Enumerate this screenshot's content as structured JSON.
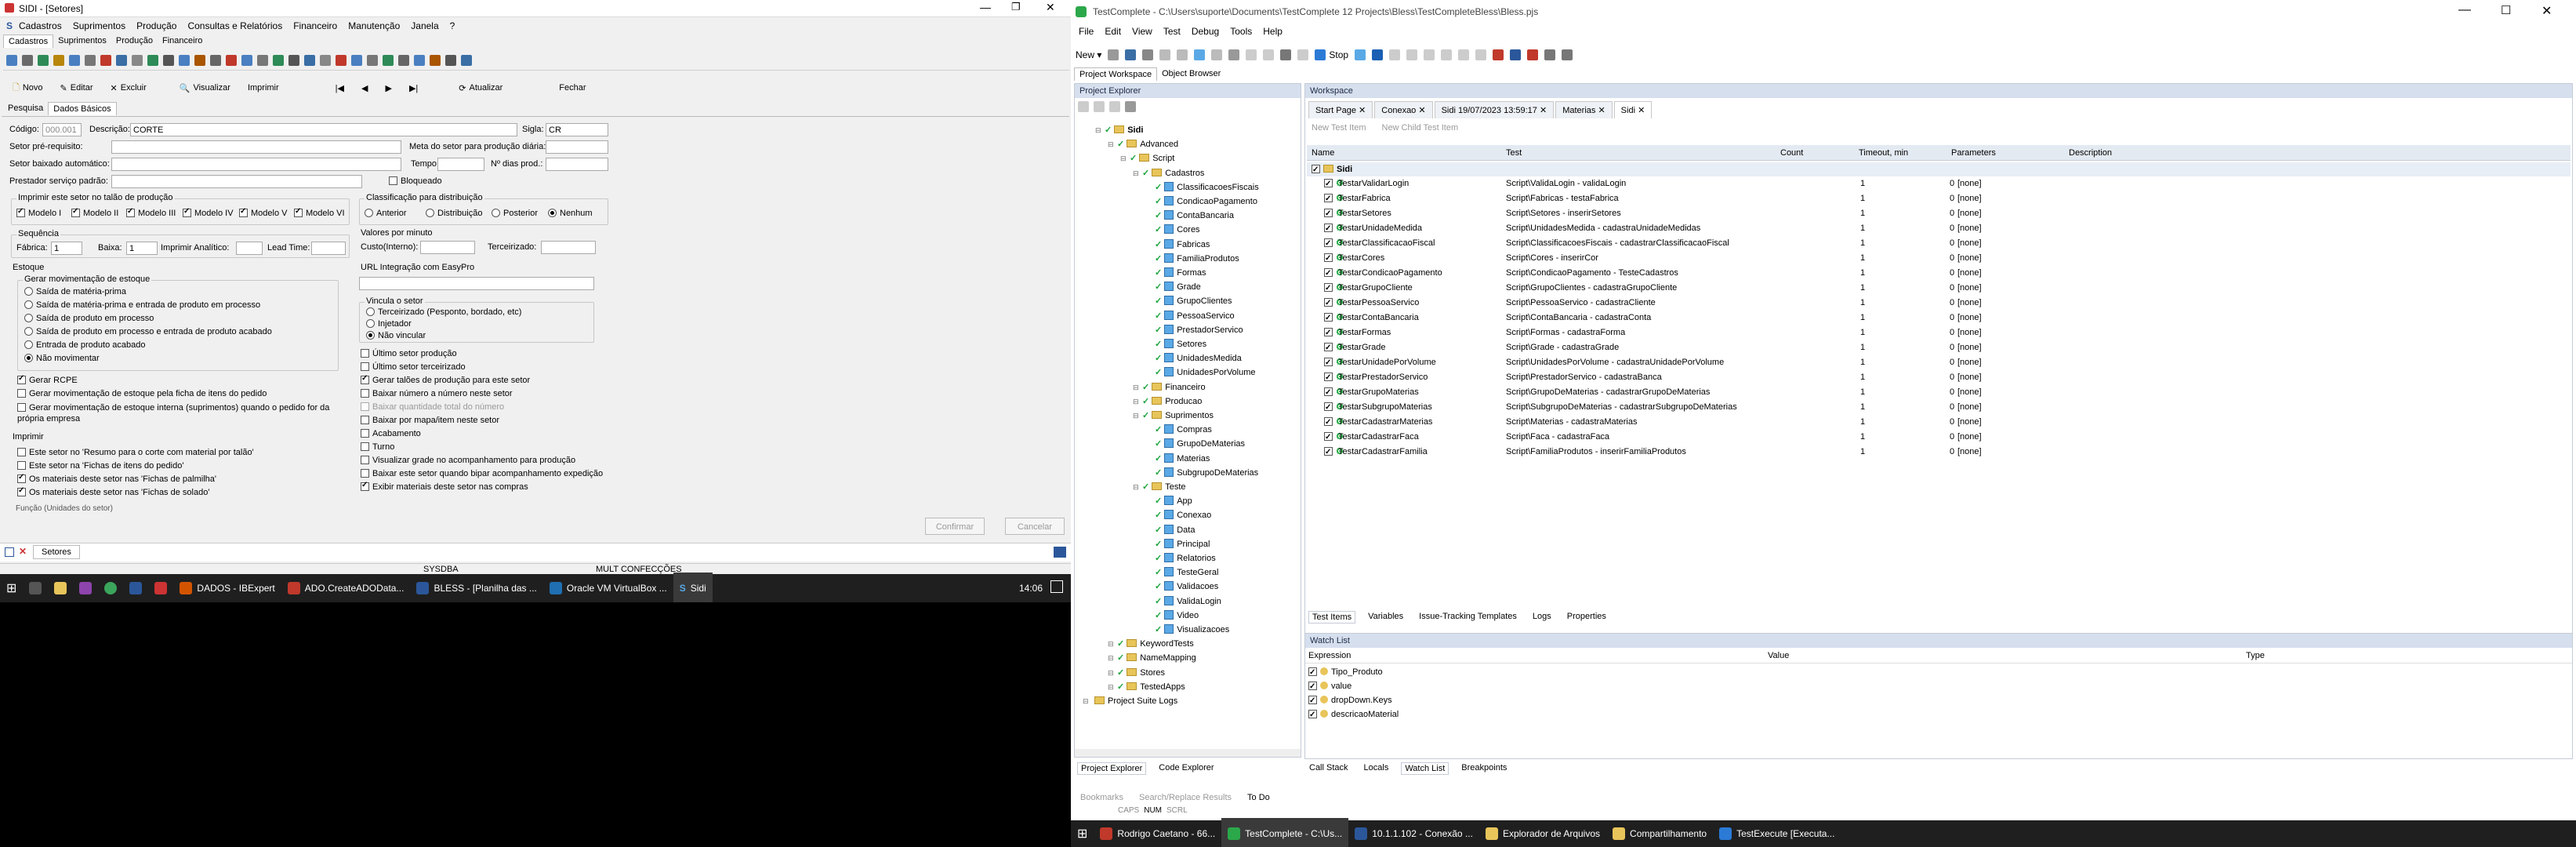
{
  "left_app": {
    "title": "SIDI - [Setores]",
    "menu": [
      "Cadastros",
      "Suprimentos",
      "Produção",
      "Consultas e Relatórios",
      "Financeiro",
      "Manutenção",
      "Janela",
      "?"
    ],
    "module_tabs": [
      "Cadastros",
      "Suprimentos",
      "Produção",
      "Financeiro"
    ],
    "actions": {
      "novo": "Novo",
      "editar": "Editar",
      "excluir": "Excluir",
      "visualizar": "Visualizar",
      "imprimir": "Imprimir",
      "atualizar": "Atualizar",
      "fechar": "Fechar"
    },
    "nav": [
      "|◀",
      "◀",
      "▶",
      "▶|"
    ],
    "form_tabs": [
      "Pesquisa",
      "Dados Básicos"
    ],
    "codigo": {
      "label": "Código:",
      "value": "000.001"
    },
    "descricao": {
      "label": "Descrição:",
      "value": "CORTE"
    },
    "sigla": {
      "label": "Sigla:",
      "value": "CR"
    },
    "setor_pre": "Setor pré-requisito:",
    "meta": "Meta do setor para produção diária:",
    "setor_baixado": "Setor baixado automático:",
    "tempo": "Tempo:",
    "dias_prod": "Nº dias prod.:",
    "prestador": "Prestador serviço padrão:",
    "bloqueado": "Bloqueado",
    "imprimir_talao": {
      "title": "Imprimir este setor no talão de produção",
      "items": [
        "Modelo I",
        "Modelo II",
        "Modelo III",
        "Modelo IV",
        "Modelo V",
        "Modelo VI"
      ]
    },
    "classificacao": {
      "title": "Classificação para distribuição",
      "items": [
        "Anterior",
        "Distribuição",
        "Posterior",
        "Nenhum"
      ]
    },
    "sequencia": {
      "title": "Sequência",
      "fabrica": "Fábrica:",
      "fabrica_val": "1",
      "baixa": "Baixa:",
      "baixa_val": "1",
      "imprimir_analitico": "Imprimir Analítico:",
      "lead_time": "Lead Time:"
    },
    "valores_minuto": {
      "title": "Valores por minuto",
      "custo_interno": "Custo(Interno):",
      "terceirizado": "Terceirizado:"
    },
    "url_integracao": "URL Integração com EasyPro",
    "estoque": {
      "title": "Estoque",
      "sub": "Gerar movimentação de estoque",
      "items": [
        "Saída de matéria-prima",
        "Saída de matéria-prima e entrada de produto em processo",
        "Saída de produto em processo",
        "Saída de produto em processo e entrada de produto acabado",
        "Entrada de produto acabado",
        "Não movimentar"
      ],
      "checks": [
        "Gerar RCPE",
        "Gerar movimentação de estoque pela ficha de itens do pedido",
        "Gerar movimentação de estoque interna (suprimentos) quando o pedido for da própria empresa"
      ]
    },
    "vincula": {
      "title": "Vincula o setor",
      "items": [
        "Terceirizado (Pesponto, bordado, etc)",
        "Injetador",
        "Não vincular"
      ]
    },
    "right_checks": [
      "Último setor produção",
      "Último setor terceirizado",
      "Gerar talões de produção para este setor",
      "Baixar número a número neste setor",
      "Baixar quantidade total do número",
      "Baixar por mapa/item neste setor",
      "Acabamento",
      "Turno",
      "Visualizar grade no acompanhamento para produção",
      "Baixar este setor quando bipar acompanhamento expedição",
      "Exibir materiais deste setor nas compras"
    ],
    "imprimir": {
      "title": "Imprimir",
      "items": [
        "Este setor no 'Resumo para o corte com material por talão'",
        "Este setor na 'Fichas de itens do pedido'",
        "Os materiais deste setor nas 'Fichas de palmilha'",
        "Os materiais deste setor nas 'Fichas de solado'"
      ]
    },
    "funcao_truncated": "Função (Unidades do setor)",
    "confirmar": "Confirmar",
    "cancelar": "Cancelar",
    "window_tab": "Setores",
    "status": [
      "SYSDBA",
      "MULT CONFECÇÕES"
    ],
    "taskbar": {
      "items": [
        "DADOS - IBExpert",
        "ADO.CreateADOData...",
        "BLESS - [Planilha das ...",
        "Oracle VM VirtualBox ...",
        "Sidi"
      ],
      "time": "14:06"
    }
  },
  "right_app": {
    "title": "TestComplete - C:\\Users\\suporte\\Documents\\TestComplete 12 Projects\\Bless\\TestCompleteBless\\Bless.pjs",
    "menu": [
      "File",
      "Edit",
      "View",
      "Test",
      "Debug",
      "Tools",
      "Help"
    ],
    "toolbar": {
      "new": "New",
      "stop": "Stop"
    },
    "top_tabs": [
      "Project Workspace",
      "Object Browser"
    ],
    "project_explorer_title": "Project Explorer",
    "tree": [
      {
        "label": "Sidi",
        "d": 1,
        "t": "root"
      },
      {
        "label": "Advanced",
        "d": 2,
        "t": "f"
      },
      {
        "label": "Script",
        "d": 3,
        "t": "f"
      },
      {
        "label": "Cadastros",
        "d": 4,
        "t": "f"
      },
      {
        "label": "ClassificacoesFiscais",
        "d": 5,
        "t": "s"
      },
      {
        "label": "CondicaoPagamento",
        "d": 5,
        "t": "s"
      },
      {
        "label": "ContaBancaria",
        "d": 5,
        "t": "s"
      },
      {
        "label": "Cores",
        "d": 5,
        "t": "s"
      },
      {
        "label": "Fabricas",
        "d": 5,
        "t": "s"
      },
      {
        "label": "FamiliaProdutos",
        "d": 5,
        "t": "s"
      },
      {
        "label": "Formas",
        "d": 5,
        "t": "s"
      },
      {
        "label": "Grade",
        "d": 5,
        "t": "s"
      },
      {
        "label": "GrupoClientes",
        "d": 5,
        "t": "s"
      },
      {
        "label": "PessoaServico",
        "d": 5,
        "t": "s"
      },
      {
        "label": "PrestadorServico",
        "d": 5,
        "t": "s"
      },
      {
        "label": "Setores",
        "d": 5,
        "t": "s"
      },
      {
        "label": "UnidadesMedida",
        "d": 5,
        "t": "s"
      },
      {
        "label": "UnidadesPorVolume",
        "d": 5,
        "t": "s"
      },
      {
        "label": "Financeiro",
        "d": 4,
        "t": "f"
      },
      {
        "label": "Producao",
        "d": 4,
        "t": "f"
      },
      {
        "label": "Suprimentos",
        "d": 4,
        "t": "f"
      },
      {
        "label": "Compras",
        "d": 5,
        "t": "s"
      },
      {
        "label": "GrupoDeMaterias",
        "d": 5,
        "t": "s"
      },
      {
        "label": "Materias",
        "d": 5,
        "t": "s"
      },
      {
        "label": "SubgrupoDeMaterias",
        "d": 5,
        "t": "s"
      },
      {
        "label": "Teste",
        "d": 4,
        "t": "f"
      },
      {
        "label": "App",
        "d": 5,
        "t": "s"
      },
      {
        "label": "Conexao",
        "d": 5,
        "t": "s"
      },
      {
        "label": "Data",
        "d": 5,
        "t": "s"
      },
      {
        "label": "Principal",
        "d": 5,
        "t": "s"
      },
      {
        "label": "Relatorios",
        "d": 5,
        "t": "s"
      },
      {
        "label": "TesteGeral",
        "d": 5,
        "t": "s"
      },
      {
        "label": "Validacoes",
        "d": 5,
        "t": "s"
      },
      {
        "label": "ValidaLogin",
        "d": 5,
        "t": "s"
      },
      {
        "label": "Video",
        "d": 5,
        "t": "s"
      },
      {
        "label": "Visualizacoes",
        "d": 5,
        "t": "s"
      },
      {
        "label": "KeywordTests",
        "d": 2,
        "t": "f"
      },
      {
        "label": "NameMapping",
        "d": 2,
        "t": "f"
      },
      {
        "label": "Stores",
        "d": 2,
        "t": "f"
      },
      {
        "label": "TestedApps",
        "d": 2,
        "t": "f"
      },
      {
        "label": "Project Suite Logs",
        "d": 0,
        "t": "f"
      }
    ],
    "left_bottom_tabs": [
      "Project Explorer",
      "Code Explorer"
    ],
    "workspace_title": "Workspace",
    "ws_tabs": [
      "Start Page",
      "Conexao",
      "Sidi 19/07/2023 13:59:17",
      "Materias",
      "Sidi"
    ],
    "new_test_item": "New Test Item",
    "new_child_item": "New Child Test Item",
    "columns": [
      "Name",
      "Test",
      "Count",
      "Timeout, min",
      "Parameters",
      "Description"
    ],
    "root_item": "Sidi",
    "rows": [
      [
        "TestarValidarLogin",
        "Script\\ValidaLogin - validaLogin",
        "1",
        "0",
        "[none]"
      ],
      [
        "TestarFabrica",
        "Script\\Fabricas - testaFabrica",
        "1",
        "0",
        "[none]"
      ],
      [
        "TestarSetores",
        "Script\\Setores - inserirSetores",
        "1",
        "0",
        "[none]"
      ],
      [
        "TestarUnidadeMedida",
        "Script\\UnidadesMedida - cadastraUnidadeMedidas",
        "1",
        "0",
        "[none]"
      ],
      [
        "TestarClassificacaoFiscal",
        "Script\\ClassificacoesFiscais - cadastrarClassificacaoFiscal",
        "1",
        "0",
        "[none]"
      ],
      [
        "TestarCores",
        "Script\\Cores - inserirCor",
        "1",
        "0",
        "[none]"
      ],
      [
        "TestarCondicaoPagamento",
        "Script\\CondicaoPagamento - TesteCadastros",
        "1",
        "0",
        "[none]"
      ],
      [
        "TestarGrupoCliente",
        "Script\\GrupoClientes - cadastraGrupoCliente",
        "1",
        "0",
        "[none]"
      ],
      [
        "TestarPessoaServico",
        "Script\\PessoaServico - cadastraCliente",
        "1",
        "0",
        "[none]"
      ],
      [
        "TestarContaBancaria",
        "Script\\ContaBancaria - cadastraConta",
        "1",
        "0",
        "[none]"
      ],
      [
        "TestarFormas",
        "Script\\Formas - cadastraForma",
        "1",
        "0",
        "[none]"
      ],
      [
        "TestarGrade",
        "Script\\Grade - cadastraGrade",
        "1",
        "0",
        "[none]"
      ],
      [
        "TestarUnidadePorVolume",
        "Script\\UnidadesPorVolume - cadastraUnidadePorVolume",
        "1",
        "0",
        "[none]"
      ],
      [
        "TestarPrestadorServico",
        "Script\\PrestadorServico - cadastraBanca",
        "1",
        "0",
        "[none]"
      ],
      [
        "TestarGrupoMaterias",
        "Script\\GrupoDeMaterias - cadastrarGrupoDeMaterias",
        "1",
        "0",
        "[none]"
      ],
      [
        "TestarSubgrupoMaterias",
        "Script\\SubgrupoDeMaterias - cadastrarSubgrupoDeMaterias",
        "1",
        "0",
        "[none]"
      ],
      [
        "TestarCadastrarMaterias",
        "Script\\Materias - cadastraMaterias",
        "1",
        "0",
        "[none]"
      ],
      [
        "TestarCadastrarFaca",
        "Script\\Faca - cadastraFaca",
        "1",
        "0",
        "[none]"
      ],
      [
        "TestarCadastrarFamilia",
        "Script\\FamiliaProdutos - inserirFamiliaProdutos",
        "1",
        "0",
        "[none]"
      ]
    ],
    "bottom_tabs": [
      "Test Items",
      "Variables",
      "Issue-Tracking Templates",
      "Logs",
      "Properties"
    ],
    "watch_title": "Watch List",
    "watch_cols": [
      "Expression",
      "Value",
      "Type"
    ],
    "watch_rows": [
      "Tipo_Produto",
      "value",
      "dropDown.Keys",
      "descricaoMaterial"
    ],
    "debug_tabs": [
      "Call Stack",
      "Locals",
      "Watch List",
      "Breakpoints"
    ],
    "lower_tabs": [
      "Bookmarks",
      "Search/Replace Results",
      "To Do"
    ],
    "status": [
      "CAPS",
      "NUM",
      "SCRL"
    ],
    "taskbar": {
      "items": [
        "Rodrigo Caetano - 66...",
        "TestComplete - C:\\Us...",
        "10.1.1.102 - Conexão ...",
        "Explorador de Arquivos",
        "Compartilhamento",
        "TestExecute [Executa..."
      ]
    }
  },
  "colors": {
    "accent": "#2b579a",
    "green": "#1aa33c",
    "folder": "#e8c55a"
  }
}
